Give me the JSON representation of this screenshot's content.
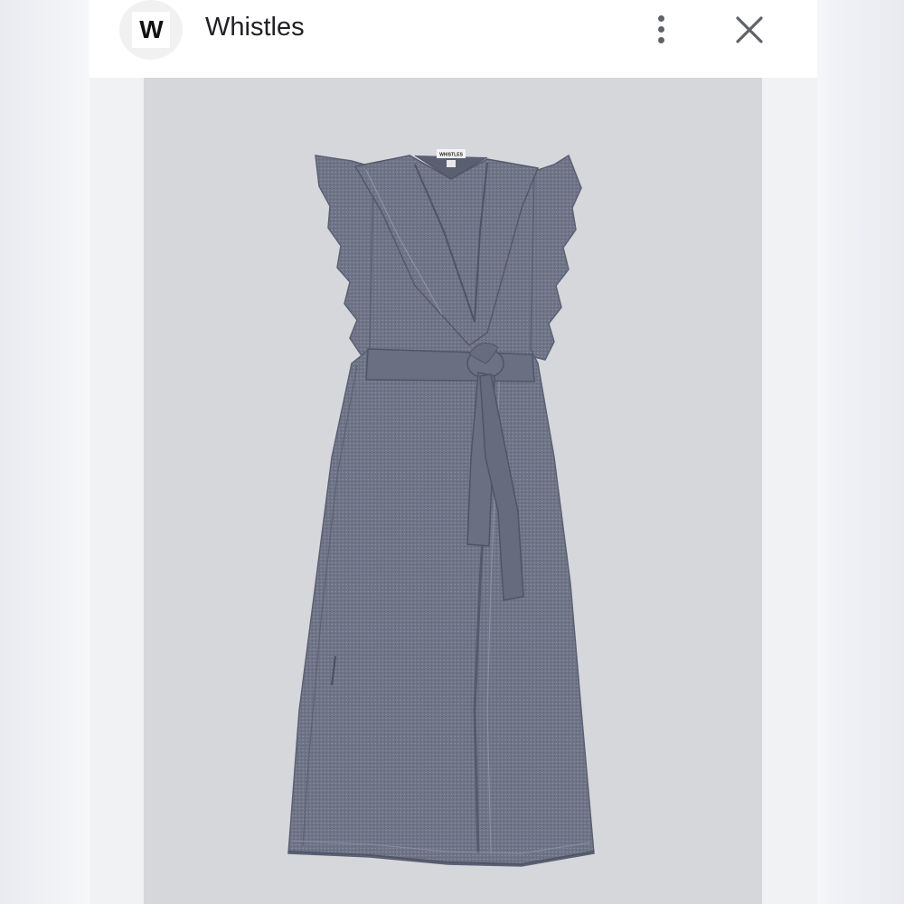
{
  "header": {
    "logo_letter": "W",
    "title": "Whistles",
    "more_icon": "more-vert-icon",
    "close_icon": "close-icon"
  },
  "product_image": {
    "subject": "dress-photo",
    "label_text": "WHISTLES",
    "colors": {
      "background": "#d6d7da",
      "fabric": "#6e7385",
      "fabric_light": "#7d8294",
      "fabric_dark": "#565b6d",
      "header_bg": "#ffffff",
      "page_bg": "#f1f2f4"
    }
  }
}
